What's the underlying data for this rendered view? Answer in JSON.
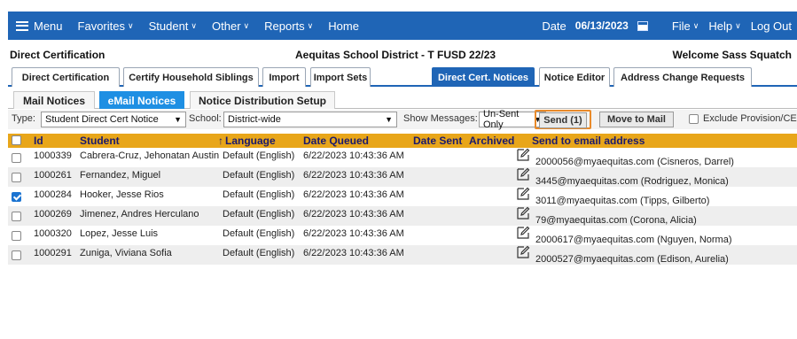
{
  "topnav": {
    "menu_label": "Menu",
    "items": [
      {
        "label": "Favorites",
        "caret": "∨"
      },
      {
        "label": "Student",
        "caret": "∨"
      },
      {
        "label": "Other",
        "caret": "∨"
      },
      {
        "label": "Reports",
        "caret": "∨"
      },
      {
        "label": "Home",
        "caret": ""
      }
    ],
    "date_label": "Date",
    "date_value": "06/13/2023",
    "right_items": [
      {
        "label": "File",
        "caret": "∨"
      },
      {
        "label": "Help",
        "caret": "∨"
      },
      {
        "label": "Log Out",
        "caret": ""
      }
    ]
  },
  "titlebar": {
    "left": "Direct Certification",
    "center": "Aequitas School District - T FUSD 22/23",
    "right": "Welcome Sass Squatch"
  },
  "tabs1": [
    {
      "label": "Direct Certification",
      "active": false
    },
    {
      "label": "Certify Household Siblings",
      "active": false
    },
    {
      "label": "Import",
      "active": false
    },
    {
      "label": "Import Sets",
      "active": false
    },
    {
      "label": "Direct Cert. Notices",
      "active": true
    },
    {
      "label": "Notice Editor",
      "active": false
    },
    {
      "label": "Address Change Requests",
      "active": false
    }
  ],
  "tabs2": [
    {
      "label": "Mail Notices",
      "active": false
    },
    {
      "label": "eMail Notices",
      "active": true
    },
    {
      "label": "Notice Distribution Setup",
      "active": false
    }
  ],
  "filters": {
    "type_label": "Type:",
    "type_value": "Student Direct Cert Notice",
    "school_label": "School:",
    "school_value": "District-wide",
    "show_label": "Show Messages:",
    "show_value": "Un-Sent Only",
    "send_button": "Send (1)",
    "move_button": "Move to Mail",
    "exclude_label": "Exclude Provision/CEP"
  },
  "grid": {
    "columns": [
      "Id",
      "Student",
      "Language",
      "Date Queued",
      "Date Sent",
      "Archived",
      "Send to email address"
    ],
    "sort_arrow": "↑",
    "rows": [
      {
        "checked": false,
        "id": "1000339",
        "student": "Cabrera-Cruz, Jehonatan Austin",
        "language": "Default (English)",
        "queued": "6/22/2023 10:43:36 AM",
        "email": "2000056@myaequitas.com (Cisneros, Darrel)"
      },
      {
        "checked": false,
        "id": "1000261",
        "student": "Fernandez, Miguel",
        "language": "Default (English)",
        "queued": "6/22/2023 10:43:36 AM",
        "email": "3445@myaequitas.com (Rodriguez, Monica)"
      },
      {
        "checked": true,
        "id": "1000284",
        "student": "Hooker, Jesse Rios",
        "language": "Default (English)",
        "queued": "6/22/2023 10:43:36 AM",
        "email": "3011@myaequitas.com (Tipps, Gilberto)"
      },
      {
        "checked": false,
        "id": "1000269",
        "student": "Jimenez, Andres Herculano",
        "language": "Default (English)",
        "queued": "6/22/2023 10:43:36 AM",
        "email": "79@myaequitas.com (Corona, Alicia)"
      },
      {
        "checked": false,
        "id": "1000320",
        "student": "Lopez, Jesse Luis",
        "language": "Default (English)",
        "queued": "6/22/2023 10:43:36 AM",
        "email": "2000617@myaequitas.com (Nguyen, Norma)"
      },
      {
        "checked": false,
        "id": "1000291",
        "student": "Zuniga, Viviana Sofia",
        "language": "Default (English)",
        "queued": "6/22/2023 10:43:36 AM",
        "email": "2000527@myaequitas.com (Edison, Aurelia)"
      }
    ]
  },
  "colors": {
    "nav_blue": "#1f65b6",
    "active_tab2": "#1e8fe3",
    "grid_header": "#e8a61a",
    "send_highlight": "#e98a2a"
  }
}
